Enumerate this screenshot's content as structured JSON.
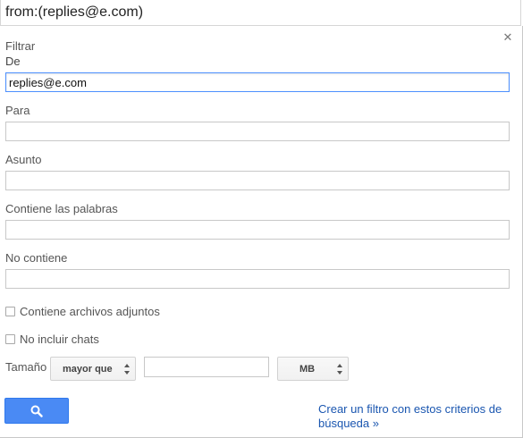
{
  "search": {
    "query": "from:(replies@e.com)"
  },
  "panel": {
    "title": "Filtrar",
    "close_icon": "close-icon",
    "fields": {
      "from_label": "De",
      "from_value": "replies@e.com",
      "to_label": "Para",
      "to_value": "",
      "subject_label": "Asunto",
      "subject_value": "",
      "has_words_label": "Contiene las palabras",
      "has_words_value": "",
      "doesnt_have_label": "No contiene",
      "doesnt_have_value": ""
    },
    "checkboxes": {
      "attachment_label": "Contiene archivos adjuntos",
      "attachment_checked": false,
      "no_chats_label": "No incluir chats",
      "no_chats_checked": false
    },
    "size": {
      "label": "Tamaño",
      "operator": "mayor que",
      "value": "",
      "unit": "MB"
    },
    "search_button_icon": "search-icon",
    "create_filter_link": "Crear un filtro con estos criterios de búsqueda »"
  },
  "colors": {
    "accent": "#4a8af4",
    "link": "#1a56b0",
    "focus_border": "#4d90fe"
  }
}
